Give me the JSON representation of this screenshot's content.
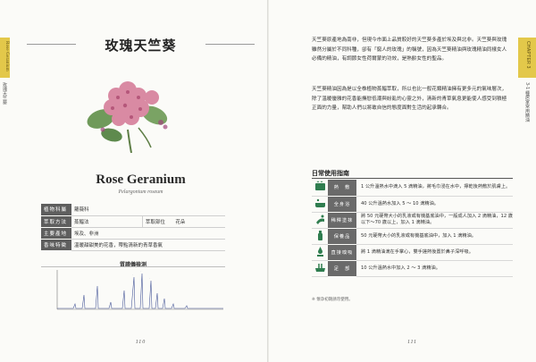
{
  "left_page": {
    "tab_label": "Rose Geranium",
    "tab_sub": "玫瑰天竺葵",
    "title_cn": "玫瑰天竺葵",
    "name_en": "Rose Geranium",
    "name_latin": "Pelargonium roseum",
    "info": {
      "family_label": "植物科屬",
      "family_value": "蘿薇科",
      "extraction_label": "萃取方法",
      "extraction_value": "蒸餾法",
      "part_label": "萃取部位",
      "part_value": "花朵",
      "origin_label": "主要產地",
      "origin_value": "埃及、非洲",
      "scent_label": "香味特徵",
      "scent_value": "溫暖甜甜美的花香，帶點清新的青草香氣"
    },
    "spec_title": "質譜儀檢測",
    "page_number": "110"
  },
  "right_page": {
    "tab_label": "CHAPTER 3",
    "tab_sub": "3-1 種居家常用精油",
    "paragraph_1": "天竺葵原產地為南非，但現今市面上品質較好的天竺葵多產於埃及與北非。天竺葵與玫瑰雖然分屬於不同科種，卻有「窮人的玫瑰」的稱號，因為天竺葵精油與玫瑰精油同樣女人必備的精油，有調節女性荷爾蒙的功效，是熟齡女性的聖品。",
    "paragraph_2": "天竺葵精油因為是以全株植物蒸餾萃取，所以也比一般花類精油擁有更多元的氣味層次，除了溫暖優雅的花香能撫慰低潮與紛亂的心靈之外，清新的青草氣息更能使人感受到積極正面的力量，幫助人們以將敢自信的態度面對生活的起承轉合。",
    "daily_title": "日常使用指南",
    "uses": [
      {
        "icon": "compress-icon",
        "label": "熱　敷",
        "desc": "1 公升溫熱水中滴入 5 滴精油，將毛巾浸在水中，擰乾後熱敷於肌膚上。"
      },
      {
        "icon": "bath-icon",
        "label": "全身浴",
        "desc": "40 公升溫熱水加入 5 ～ 10 滴精油。"
      },
      {
        "icon": "massage-icon",
        "label": "稀釋塗抹",
        "desc": "將 50 元硬幣大小的乳液或有機基底油中，一般成人加入 2 滴精油，12 歲以下～70 歲以上，加入 1 滴精油。"
      },
      {
        "icon": "skincare-icon",
        "label": "保養品",
        "desc": "50 元硬幣大小的乳液或有機基底油中，加入 1 滴精油。"
      },
      {
        "icon": "inhale-icon",
        "label": "直接嗅吸",
        "desc": "將 1 滴精油滴在手掌心，雙手搓熱後置於鼻子深呼吸。"
      },
      {
        "icon": "footbath-icon",
        "label": "足　部",
        "desc": "10 公升溫熱水中加入 2 ～ 3 滴精油。"
      }
    ],
    "note": "※ 懷孕初期請勿使用。",
    "page_number": "111"
  },
  "colors": {
    "tab_yellow": "#e3c84a",
    "header_gray": "#5e5e5e",
    "icon_green": "#2f7d4f",
    "flower_pink": "#d98aa3"
  }
}
